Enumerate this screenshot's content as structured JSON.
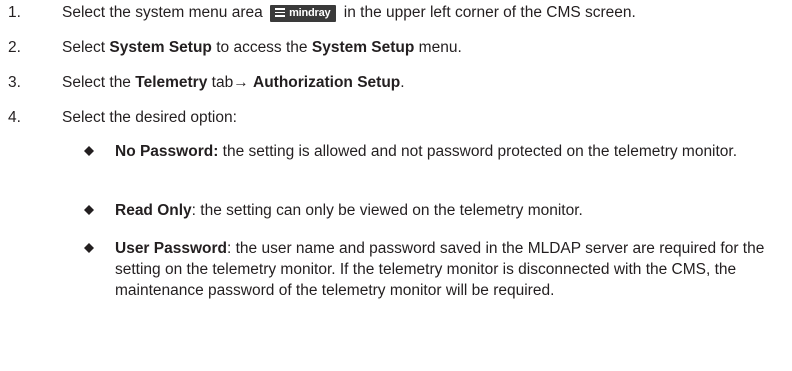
{
  "steps": [
    {
      "num": "1.",
      "pre": "Select the system menu area",
      "logo": "mindray",
      "post": "in the upper left corner of the CMS screen."
    },
    {
      "num": "2.",
      "t1": "Select ",
      "b1": "System Setup",
      "t2": " to access the ",
      "b2": "System Setup",
      "t3": " menu."
    },
    {
      "num": "3.",
      "t1": "Select the ",
      "b1": "Telemetry",
      "t2": " tab→ ",
      "b2": "Authorization Setup",
      "t3": "."
    },
    {
      "num": "4.",
      "text": "Select the desired option:"
    }
  ],
  "options": [
    {
      "term": "No Password:",
      "desc": " the setting is allowed and not password protected on the telemetry monitor."
    },
    {
      "term": "Read Only",
      "desc": ": the setting can only be viewed on the telemetry monitor."
    },
    {
      "term": "User Password",
      "desc": ": the user name and password saved in the MLDAP server are required for the setting on the telemetry monitor. If the telemetry monitor is disconnected with the CMS, the maintenance password of the telemetry monitor will be required."
    }
  ],
  "colors": {
    "text": "#231f20",
    "logo_bg": "#3a3a3a",
    "bullet": "#231f20"
  },
  "icons": {
    "menu": "hamburger-menu-icon",
    "bullet": "diamond-bullet-icon"
  }
}
